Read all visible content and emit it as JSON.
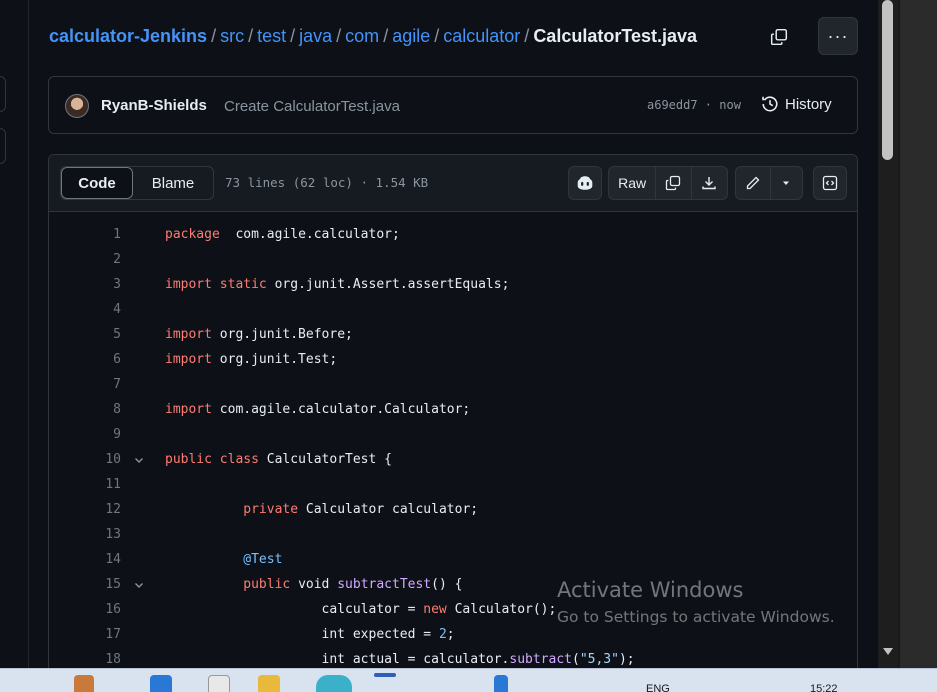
{
  "breadcrumb": {
    "repo": "calculator-Jenkins",
    "parts": [
      "src",
      "test",
      "java",
      "com",
      "agile",
      "calculator"
    ],
    "separator": "/",
    "file": "CalculatorTest.java"
  },
  "more_button": "···",
  "commit": {
    "author": "RyanB-Shields",
    "message": "Create CalculatorTest.java",
    "hash_time": "a69edd7 · now",
    "history_label": "History"
  },
  "file_header": {
    "code_tab": "Code",
    "blame_tab": "Blame",
    "meta": "73 lines (62 loc) · 1.54 KB",
    "raw_label": "Raw"
  },
  "code_lines": [
    {
      "n": "1",
      "fold": false,
      "tokens": [
        [
          "kw",
          "package"
        ],
        [
          "",
          "  com.agile.calculator;"
        ]
      ]
    },
    {
      "n": "2",
      "fold": false,
      "tokens": []
    },
    {
      "n": "3",
      "fold": false,
      "tokens": [
        [
          "kw",
          "import"
        ],
        [
          "",
          " "
        ],
        [
          "kw",
          "static"
        ],
        [
          "",
          " org.junit.Assert.assertEquals;"
        ]
      ]
    },
    {
      "n": "4",
      "fold": false,
      "tokens": []
    },
    {
      "n": "5",
      "fold": false,
      "tokens": [
        [
          "kw",
          "import"
        ],
        [
          "",
          " org.junit.Before;"
        ]
      ]
    },
    {
      "n": "6",
      "fold": false,
      "tokens": [
        [
          "kw",
          "import"
        ],
        [
          "",
          " org.junit.Test;"
        ]
      ]
    },
    {
      "n": "7",
      "fold": false,
      "tokens": []
    },
    {
      "n": "8",
      "fold": false,
      "tokens": [
        [
          "kw",
          "import"
        ],
        [
          "",
          " com.agile.calculator.Calculator;"
        ]
      ]
    },
    {
      "n": "9",
      "fold": false,
      "tokens": []
    },
    {
      "n": "10",
      "fold": true,
      "tokens": [
        [
          "kw",
          "public"
        ],
        [
          "",
          " "
        ],
        [
          "kw",
          "class"
        ],
        [
          "",
          " CalculatorTest {"
        ]
      ]
    },
    {
      "n": "11",
      "fold": false,
      "tokens": []
    },
    {
      "n": "12",
      "fold": false,
      "tokens": [
        [
          "",
          "          "
        ],
        [
          "kw",
          "private"
        ],
        [
          "",
          " Calculator calculator;"
        ]
      ]
    },
    {
      "n": "13",
      "fold": false,
      "tokens": []
    },
    {
      "n": "14",
      "fold": false,
      "tokens": [
        [
          "",
          "          "
        ],
        [
          "an",
          "@Test"
        ]
      ]
    },
    {
      "n": "15",
      "fold": true,
      "tokens": [
        [
          "",
          "          "
        ],
        [
          "kw",
          "public"
        ],
        [
          "",
          " void "
        ],
        [
          "fn",
          "subtractTest"
        ],
        [
          "",
          "() {"
        ]
      ]
    },
    {
      "n": "16",
      "fold": false,
      "tokens": [
        [
          "",
          "                    calculator = "
        ],
        [
          "kw",
          "new"
        ],
        [
          "",
          " Calculator();"
        ]
      ]
    },
    {
      "n": "17",
      "fold": false,
      "tokens": [
        [
          "",
          "                    int expected = "
        ],
        [
          "an",
          "2"
        ],
        [
          "",
          ";"
        ]
      ]
    },
    {
      "n": "18",
      "fold": false,
      "tokens": [
        [
          "",
          "                    int actual = calculator."
        ],
        [
          "fn",
          "subtract"
        ],
        [
          "",
          "("
        ],
        [
          "st",
          "\"5,3\""
        ],
        [
          "",
          ");"
        ]
      ]
    }
  ],
  "watermark": {
    "title": "Activate Windows",
    "subtitle": "Go to Settings to activate Windows."
  },
  "taskbar": {
    "lang": "ENG",
    "time": "15:22"
  }
}
